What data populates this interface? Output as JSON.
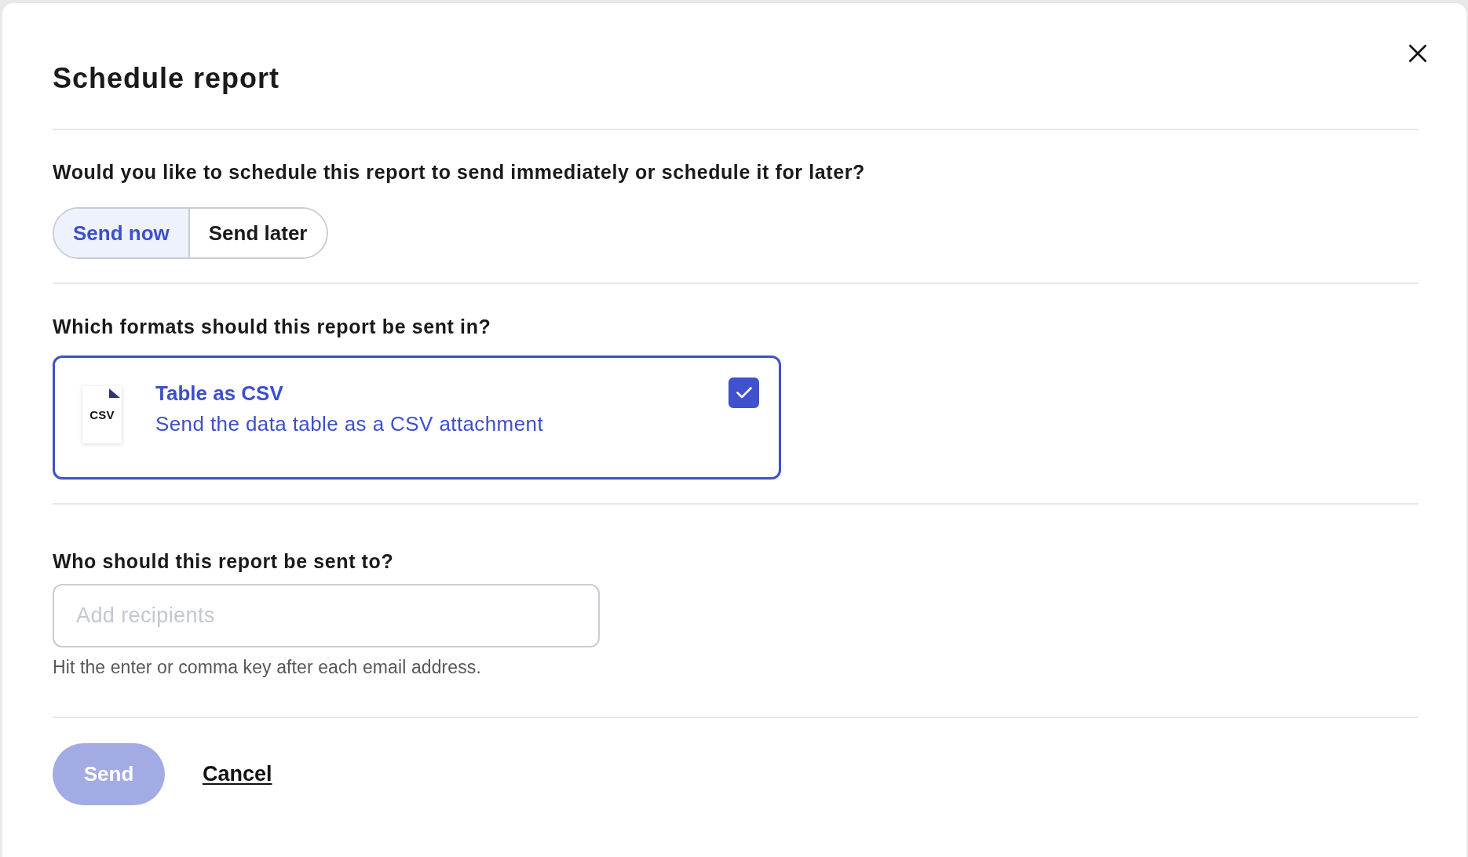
{
  "dialog": {
    "title": "Schedule report"
  },
  "schedule": {
    "question": "Would you like to schedule this report to send immediately or schedule it for later?",
    "options": [
      {
        "label": "Send now",
        "selected": true
      },
      {
        "label": "Send later",
        "selected": false
      }
    ]
  },
  "formats": {
    "question": "Which formats should this report be sent in?",
    "options": [
      {
        "badge": "CSV",
        "title": "Table as CSV",
        "description": "Send the data table as a CSV attachment",
        "checked": true
      }
    ]
  },
  "recipients": {
    "question": "Who should this report be sent to?",
    "placeholder": "Add recipients",
    "hint": "Hit the enter or comma key after each email address."
  },
  "actions": [
    {
      "label": "Send",
      "kind": "primary",
      "disabled": true
    },
    {
      "label": "Cancel",
      "kind": "link",
      "disabled": false
    }
  ]
}
